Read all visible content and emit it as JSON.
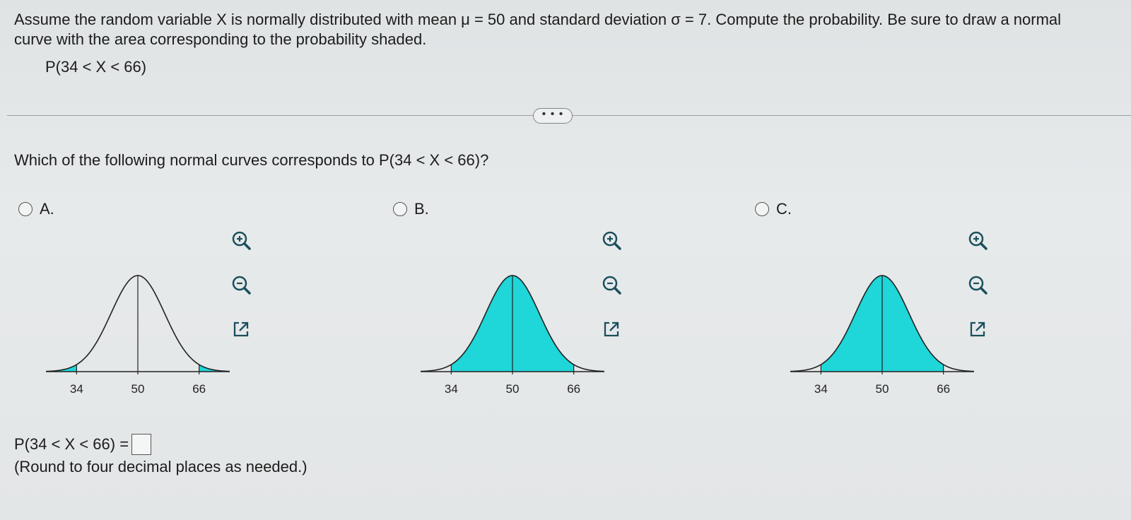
{
  "prompt": {
    "line1": "Assume the random variable X is normally distributed with mean μ = 50 and standard deviation σ = 7. Compute the probability. Be sure to draw a normal",
    "line2": "curve with the area corresponding to the probability shaded.",
    "probability": "P(34 < X < 66)"
  },
  "more_button": "• • •",
  "question": "Which of the following normal curves corresponds to P(34 < X < 66)?",
  "options": [
    {
      "label": "A.",
      "ticks": [
        "34",
        "50",
        "66"
      ],
      "shading": "tails"
    },
    {
      "label": "B.",
      "ticks": [
        "34",
        "50",
        "66"
      ],
      "shading": "middle"
    },
    {
      "label": "C.",
      "ticks": [
        "34",
        "50",
        "66"
      ],
      "shading": "middle"
    }
  ],
  "icons": [
    "zoom-in-icon",
    "zoom-out-icon",
    "expand-icon"
  ],
  "answer": {
    "label": "P(34 < X < 66) =",
    "value": ""
  },
  "round_note": "(Round to four decimal places as needed.)",
  "colors": {
    "fill": "#1fd6d8",
    "text": "#1c1c1c",
    "icon": "#1a4f5c"
  }
}
